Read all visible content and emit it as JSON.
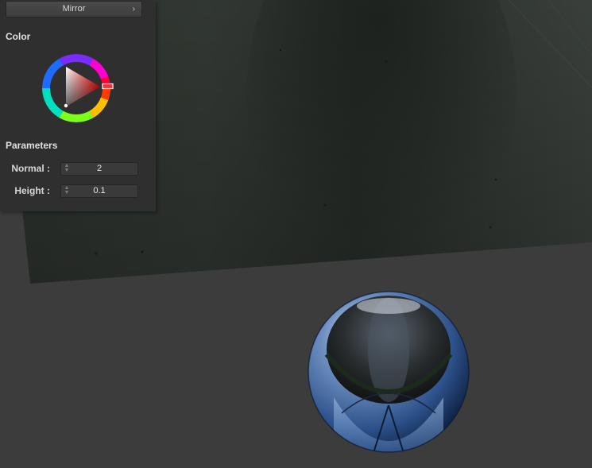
{
  "panel": {
    "mode_dropdown": {
      "label": "Mirror",
      "chevron": "›"
    },
    "color_section": {
      "title": "Color"
    },
    "parameters_section": {
      "title": "Parameters"
    },
    "params": [
      {
        "label": "Normal :",
        "value": "2"
      },
      {
        "label": "Height :",
        "value": "0.1"
      }
    ],
    "spinner_icon": "up-down-arrows",
    "color_picker": {
      "selected_hue": "#ff0000",
      "ring_handle_color": "#e23a3a"
    }
  },
  "scene": {
    "floor_color": "#3c3c3c",
    "backdrop_color": "#2b302c",
    "sphere_material": "mirror"
  }
}
